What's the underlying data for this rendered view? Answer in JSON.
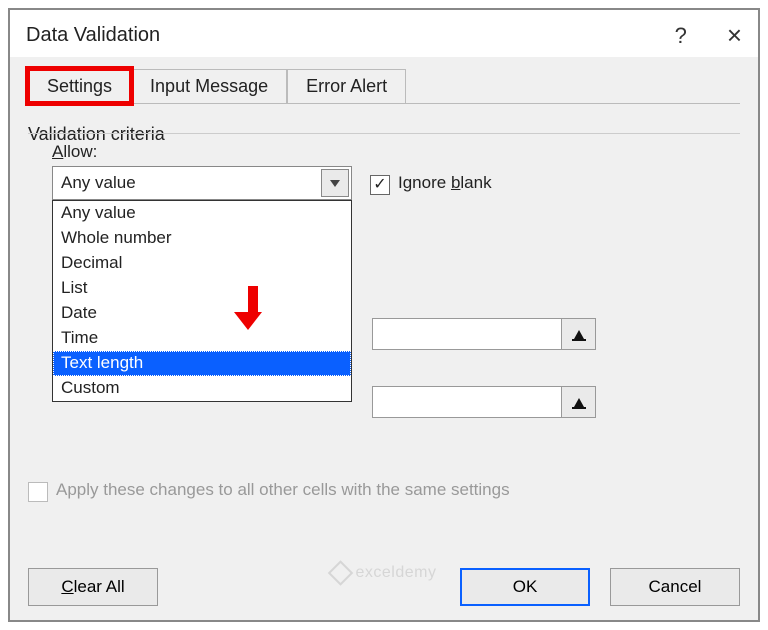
{
  "dialog": {
    "title": "Data Validation",
    "help_icon": "?",
    "close_icon": "×"
  },
  "tabs": {
    "items": [
      "Settings",
      "Input Message",
      "Error Alert"
    ],
    "active": 0
  },
  "criteria": {
    "legend": "Validation criteria",
    "allow_label": "Allow:",
    "allow_value": "Any value",
    "allow_options": [
      "Any value",
      "Whole number",
      "Decimal",
      "List",
      "Date",
      "Time",
      "Text length",
      "Custom"
    ],
    "allow_selected_index": 6,
    "ignore_blank_label": "Ignore blank",
    "ignore_blank_checked": true
  },
  "apply_label": "Apply these changes to all other cells with the same settings",
  "apply_checked": false,
  "buttons": {
    "clear_all": "Clear All",
    "ok": "OK",
    "cancel": "Cancel"
  },
  "watermark": "exceldemy"
}
